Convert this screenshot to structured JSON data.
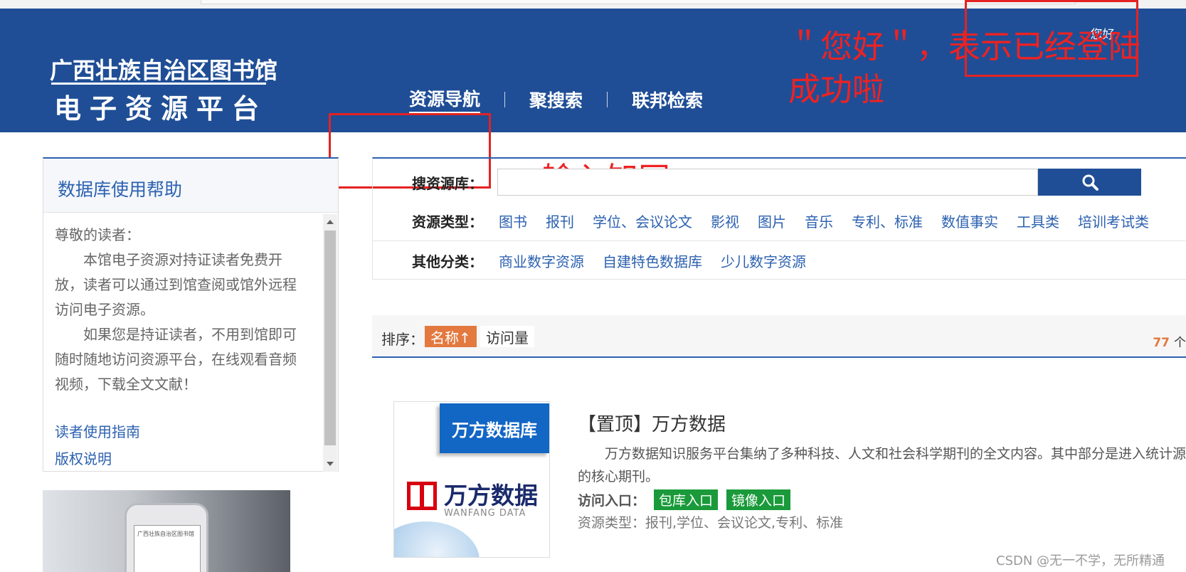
{
  "header": {
    "logo_line1": "广西壮族自治区图书馆",
    "logo_line2": "电子资源平台",
    "nav": [
      "资源导航",
      "聚搜索",
      "联邦检索"
    ],
    "greeting": "您好."
  },
  "annotations": {
    "login_note": "＂您好＂，表示已经登陆成功啦",
    "input_note": "输入知网"
  },
  "sidebar": {
    "title": "数据库使用帮助",
    "greeting": "尊敬的读者：",
    "para1": "本馆电子资源对持证读者免费开放，读者可以通过到馆查阅或馆外远程访问电子资源。",
    "para2": "如果您是持证读者，不用到馆即可随时随地访问资源平台，在线观看音频视频，下载全文文献！",
    "links": [
      "读者使用指南",
      "版权说明"
    ],
    "phone_text": "广西壮族自治区图书馆"
  },
  "search": {
    "label": "搜资源库：",
    "input_value": "",
    "icon": "search-icon",
    "type_label": "资源类型：",
    "types": [
      "图书",
      "报刊",
      "学位、会议论文",
      "影视",
      "图片",
      "音乐",
      "专利、标准",
      "数值事实",
      "工具类",
      "培训考试类"
    ],
    "other_label": "其他分类：",
    "others": [
      "商业数字资源",
      "自建特色数据库",
      "少儿数字资源"
    ]
  },
  "sort": {
    "label": "排序：",
    "active": "名称↑",
    "plain": "访问量",
    "count_num": "77",
    "count_unit": "个"
  },
  "card": {
    "banner": "万方数据库",
    "brand_cn": "万方数据",
    "brand_en": "WANFANG DATA",
    "title": "【置顶】万方数据",
    "desc": "万方数据知识服务平台集纳了多种科技、人文和社会科学期刊的全文内容。其中部分是进入统计源的核心期刊。",
    "entry_label": "访问入口：",
    "entry1": "包库入口",
    "entry2": "镜像入口",
    "type": "资源类型：报刊,学位、会议论文,专利、标准"
  },
  "watermark": "CSDN @无一不学，无所精通",
  "colors": {
    "header_bg": "#1f4e96",
    "link": "#2c61b0",
    "accent": "#e3793f",
    "entry_btn": "#1a9a3a",
    "annotation": "#e52222"
  }
}
